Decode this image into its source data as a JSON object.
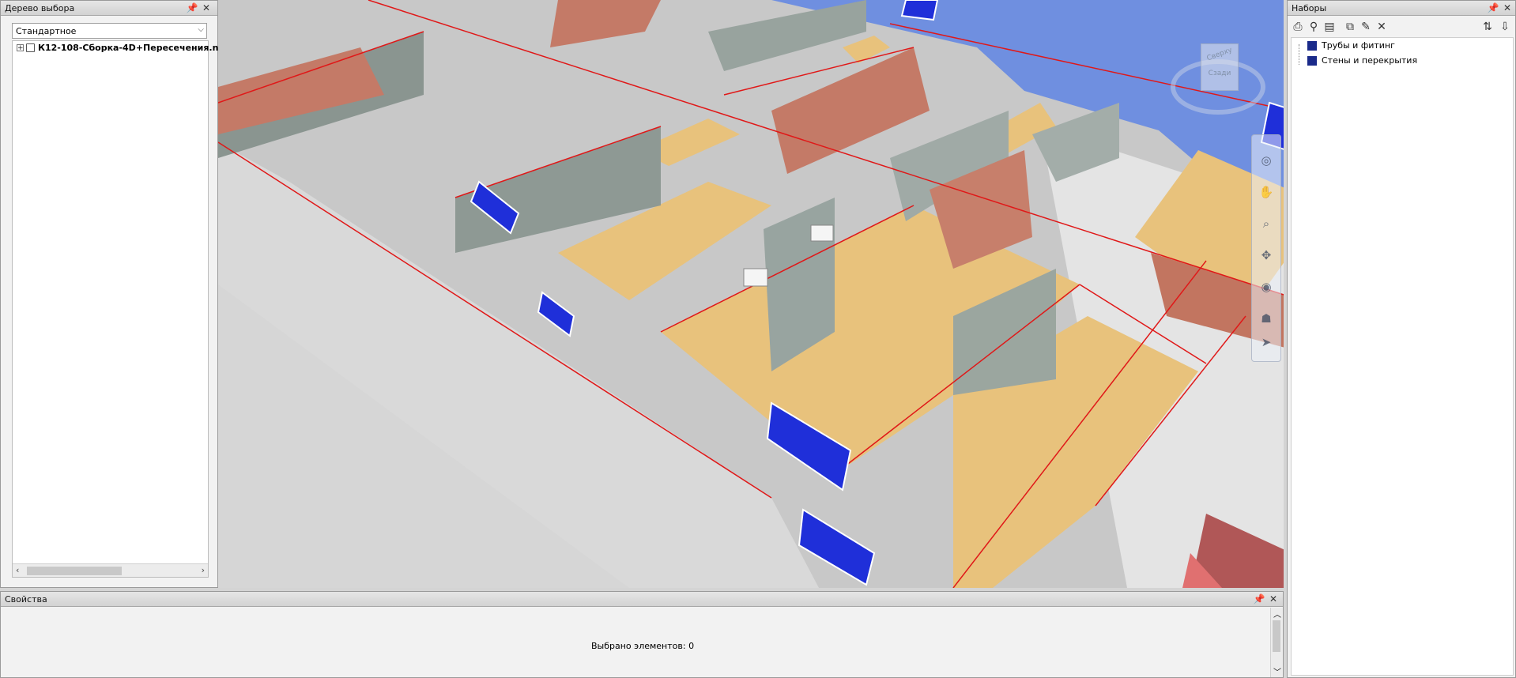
{
  "left_panel": {
    "title": "Дерево выбора",
    "dropdown_value": "Стандартное",
    "tree_item": "К12-108-Сборка-4D+Пересечения.n"
  },
  "right_panel": {
    "title": "Наборы",
    "items": [
      "Трубы и фитинг",
      "Стены и перекрытия"
    ]
  },
  "bottom_panel": {
    "title": "Свойства",
    "status": "Выбрано элементов: 0"
  },
  "viewcube": {
    "top_label": "Сверху",
    "front_label": "Сзади"
  },
  "icons": {
    "pin": "pin-icon",
    "close": "close-icon",
    "expand": "plus-icon",
    "set": "selection-set-icon",
    "sort": "sort-icon",
    "nav_wheel": "steering-wheel-icon",
    "pan": "pan-hand-icon",
    "zoom": "zoom-icon",
    "orbit": "orbit-icon",
    "look": "look-icon",
    "walk": "walk-icon",
    "select": "select-arrow-icon"
  },
  "colors": {
    "sky": "#6f8fe0",
    "floor": "#e8c27c",
    "wall_red": "#c47a67",
    "wall_grey": "#8a9590",
    "window_blue": "#1f2fd9",
    "edge_red": "#e01818"
  }
}
